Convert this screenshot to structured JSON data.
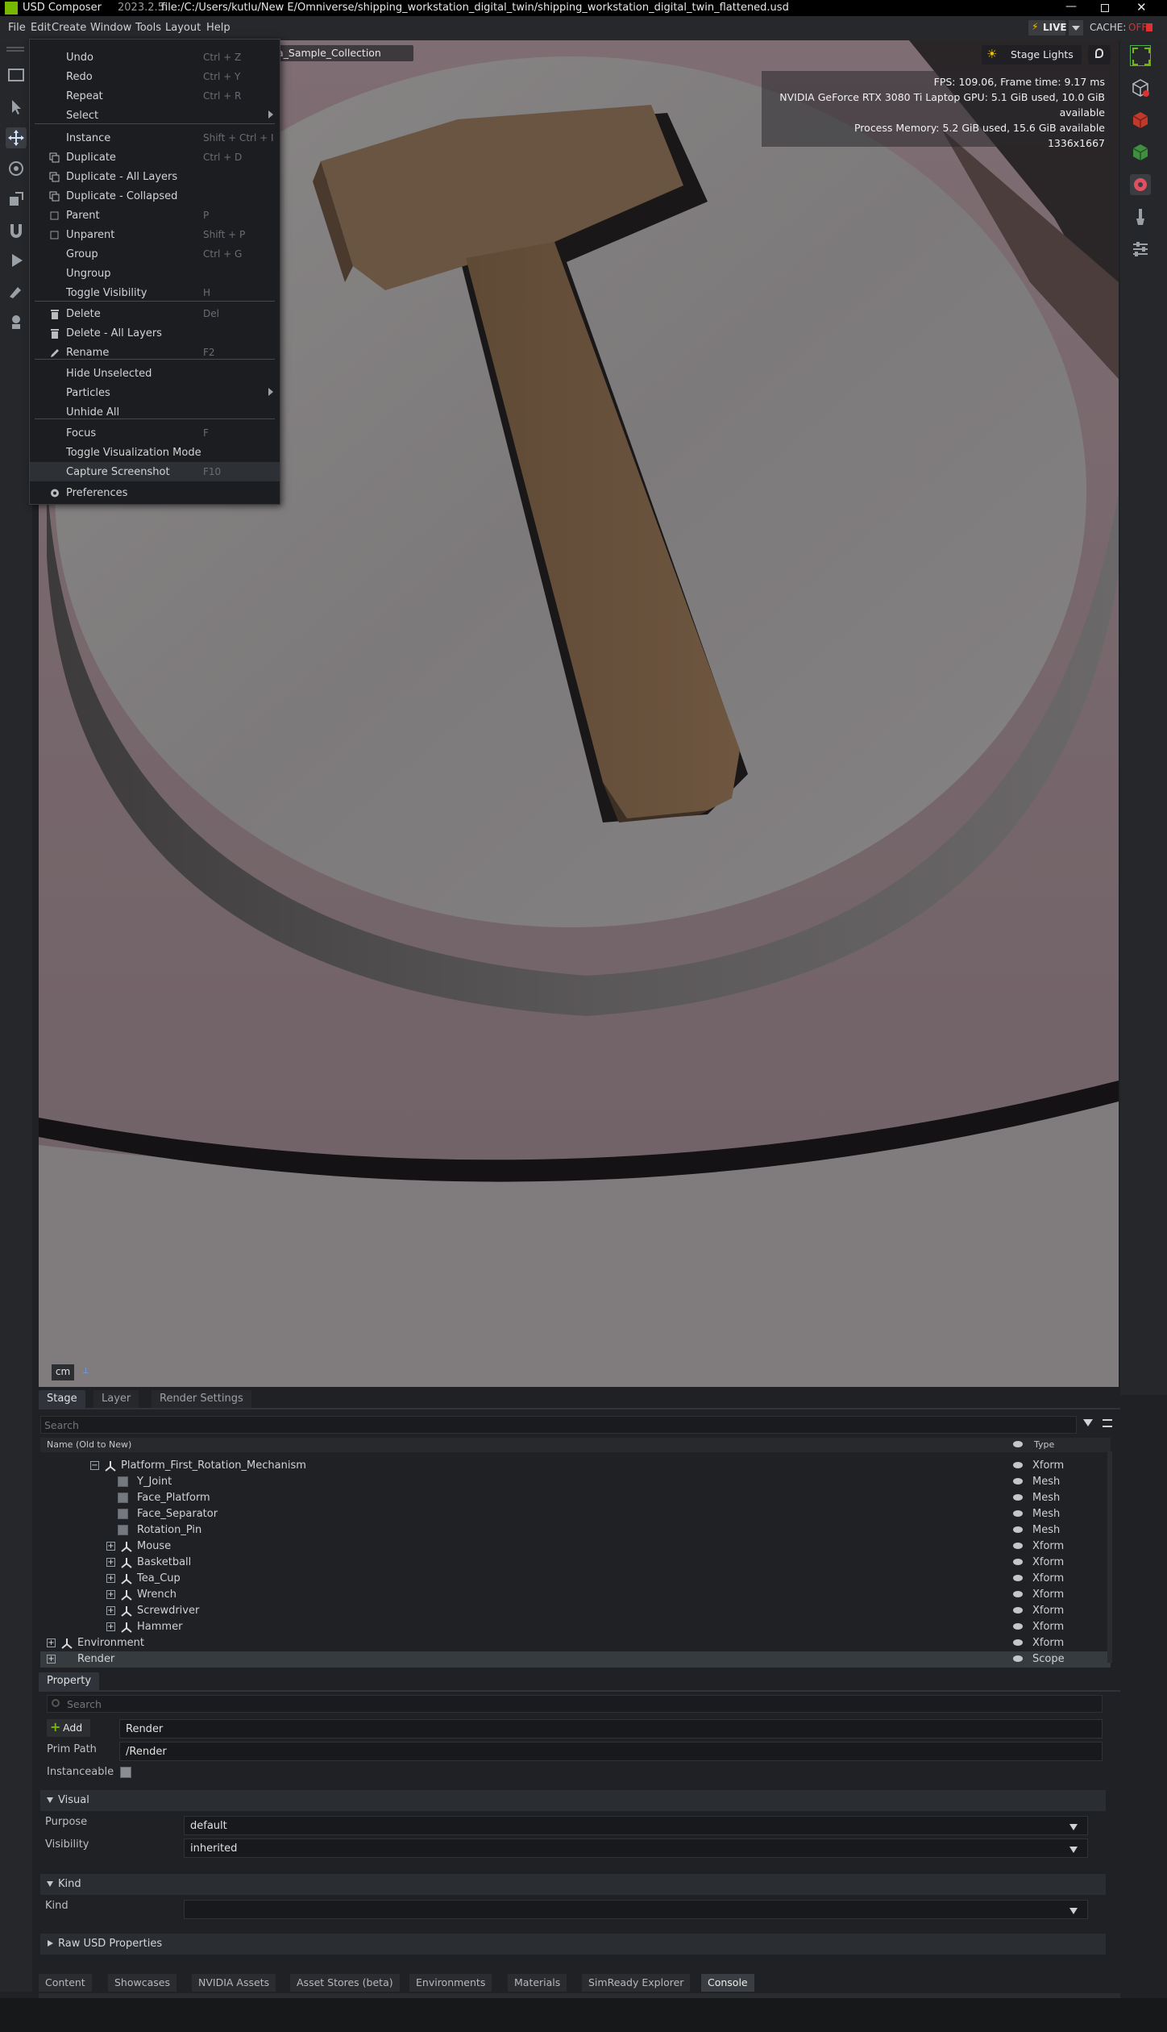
{
  "titlebar": {
    "app": "USD Composer",
    "version": "2023.2.5",
    "file": "file:/C:/Users/kutlu/New E/Omniverse/shipping_workstation_digital_twin/shipping_workstation_digital_twin_flattened.usd",
    "window_controls": [
      "minimize",
      "restore",
      "close"
    ]
  },
  "menubar": {
    "items": [
      "File",
      "Edit",
      "Create",
      "Window",
      "Tools",
      "Layout",
      "Help"
    ],
    "live_label": "LIVE",
    "cache_label": "CACHE:",
    "cache_state": "OFF"
  },
  "edit_menu": {
    "items": [
      {
        "label": "Undo",
        "shortcut": "Ctrl + Z",
        "icon": ""
      },
      {
        "label": "Redo",
        "shortcut": "Ctrl + Y",
        "icon": ""
      },
      {
        "label": "Repeat",
        "shortcut": "Ctrl + R",
        "icon": ""
      },
      {
        "label": "Select",
        "shortcut": "",
        "icon": "",
        "submenu": true
      },
      {
        "label": "Instance",
        "shortcut": "Shift + Ctrl + I",
        "icon": ""
      },
      {
        "label": "Duplicate",
        "shortcut": "Ctrl + D",
        "icon": "duplicate-icon"
      },
      {
        "label": "Duplicate - All Layers",
        "shortcut": "",
        "icon": "duplicate-icon"
      },
      {
        "label": "Duplicate - Collapsed",
        "shortcut": "",
        "icon": "duplicate-icon"
      },
      {
        "label": "Parent",
        "shortcut": "P",
        "icon": "parent-icon"
      },
      {
        "label": "Unparent",
        "shortcut": "Shift + P",
        "icon": "unparent-icon"
      },
      {
        "label": "Group",
        "shortcut": "Ctrl + G",
        "icon": ""
      },
      {
        "label": "Ungroup",
        "shortcut": "",
        "icon": ""
      },
      {
        "label": "Toggle Visibility",
        "shortcut": "H",
        "icon": ""
      },
      {
        "label": "Delete",
        "shortcut": "Del",
        "icon": "trash-icon"
      },
      {
        "label": "Delete - All Layers",
        "shortcut": "",
        "icon": "trash-icon"
      },
      {
        "label": "Rename",
        "shortcut": "F2",
        "icon": "pencil-icon"
      },
      {
        "label": "Hide Unselected",
        "shortcut": "",
        "icon": ""
      },
      {
        "label": "Particles",
        "shortcut": "",
        "icon": "",
        "submenu": true
      },
      {
        "label": "Unhide All",
        "shortcut": "",
        "icon": ""
      },
      {
        "label": "Focus",
        "shortcut": "F",
        "icon": ""
      },
      {
        "label": "Toggle Visualization Mode",
        "shortcut": "",
        "icon": ""
      },
      {
        "label": "Capture Screenshot",
        "shortcut": "F10",
        "icon": ""
      },
      {
        "label": "Preferences",
        "shortcut": "",
        "icon": "gear-icon"
      }
    ]
  },
  "viewport": {
    "camera_label": "a_Sample_Collection",
    "stage_lights_label": "Stage Lights",
    "stats": [
      "FPS: 109.06, Frame time: 9.17 ms",
      "NVIDIA GeForce RTX 3080 Ti Laptop GPU: 5.1 GiB used, 10.0 GiB available",
      "Process Memory: 5.2 GiB used, 15.6 GiB available",
      "1336x1667"
    ],
    "unit_label": "cm"
  },
  "stage_panel": {
    "tabs": [
      "Stage",
      "Layer",
      "Render Settings"
    ],
    "search_placeholder": "Search",
    "col_name": "Name (Old to New)",
    "col_type": "Type",
    "rows": [
      {
        "name": "Platform_First_Rotation_Mechanism",
        "type": "Xform",
        "kind": "xform",
        "depth": 3,
        "expand": "minus"
      },
      {
        "name": "Y_Joint",
        "type": "Mesh",
        "kind": "mesh",
        "depth": 4,
        "expand": ""
      },
      {
        "name": "Face_Platform",
        "type": "Mesh",
        "kind": "mesh",
        "depth": 4,
        "expand": ""
      },
      {
        "name": "Face_Separator",
        "type": "Mesh",
        "kind": "mesh",
        "depth": 4,
        "expand": ""
      },
      {
        "name": "Rotation_Pin",
        "type": "Mesh",
        "kind": "mesh",
        "depth": 4,
        "expand": ""
      },
      {
        "name": "Mouse",
        "type": "Xform",
        "kind": "xform",
        "depth": 4,
        "expand": "plus"
      },
      {
        "name": "Basketball",
        "type": "Xform",
        "kind": "xform",
        "depth": 4,
        "expand": "plus"
      },
      {
        "name": "Tea_Cup",
        "type": "Xform",
        "kind": "xform",
        "depth": 4,
        "expand": "plus"
      },
      {
        "name": "Wrench",
        "type": "Xform",
        "kind": "xform",
        "depth": 4,
        "expand": "plus"
      },
      {
        "name": "Screwdriver",
        "type": "Xform",
        "kind": "xform",
        "depth": 4,
        "expand": "plus"
      },
      {
        "name": "Hammer",
        "type": "Xform",
        "kind": "xform",
        "depth": 4,
        "expand": "plus"
      },
      {
        "name": "Environment",
        "type": "Xform",
        "kind": "xform",
        "depth": 0,
        "expand": "plus"
      },
      {
        "name": "Render",
        "type": "Scope",
        "kind": "scope",
        "depth": 0,
        "expand": "plus",
        "selected": true
      }
    ]
  },
  "property_panel": {
    "tab": "Property",
    "search_placeholder": "Search",
    "add_label": "Add",
    "name_value": "Render",
    "prim_path_label": "Prim Path",
    "prim_path_value": "/Render",
    "instanceable_label": "Instanceable",
    "visual_section": "Visual",
    "purpose_label": "Purpose",
    "purpose_value": "default",
    "visibility_label": "Visibility",
    "visibility_value": "inherited",
    "kind_section": "Kind",
    "kind_label": "Kind",
    "kind_value": "",
    "raw_section": "Raw USD Properties"
  },
  "bottom_tabs": [
    "Content",
    "Showcases",
    "NVIDIA Assets",
    "Asset Stores (beta)",
    "Environments",
    "Materials",
    "SimReady Explorer",
    "Console"
  ],
  "colors": {
    "accent": "#76b900",
    "live": "#f2c200",
    "cache_off": "#e03030"
  }
}
